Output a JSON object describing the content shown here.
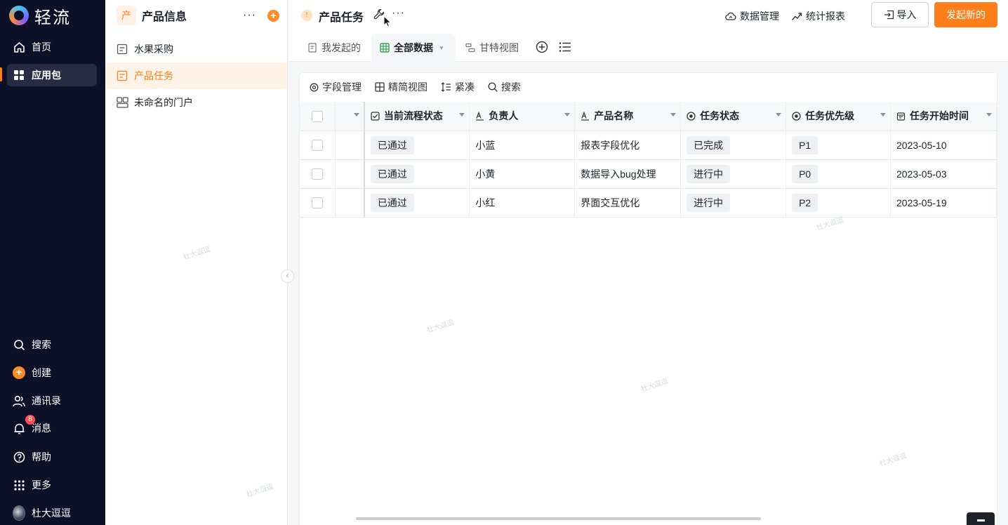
{
  "nav": {
    "brand": "轻流",
    "items": [
      {
        "label": "首页",
        "icon": "home-icon"
      },
      {
        "label": "应用包",
        "icon": "apps-icon"
      }
    ],
    "bottom": [
      {
        "label": "搜索",
        "icon": "search-icon"
      },
      {
        "label": "创建",
        "icon": "plus-icon"
      },
      {
        "label": "通讯录",
        "icon": "contacts-icon"
      },
      {
        "label": "消息",
        "icon": "bell-icon",
        "badge": "8"
      },
      {
        "label": "帮助",
        "icon": "help-icon"
      },
      {
        "label": "更多",
        "icon": "grid-icon"
      },
      {
        "label": "杜大逗逗",
        "icon": "avatar"
      }
    ]
  },
  "package": {
    "icon_text": "产",
    "title": "产品信息",
    "items": [
      {
        "label": "水果采购"
      },
      {
        "label": "产品任务"
      },
      {
        "label": "未命名的门户"
      }
    ]
  },
  "header": {
    "form_title": "产品任务",
    "links": [
      "数据管理",
      "统计报表"
    ],
    "import_label": "导入",
    "new_label": "发起新的"
  },
  "tabs": [
    {
      "label": "我发起的"
    },
    {
      "label": "全部数据"
    },
    {
      "label": "甘特视图"
    }
  ],
  "toolbar": [
    "字段管理",
    "精简视图",
    "紧凑",
    "搜索"
  ],
  "table": {
    "columns": [
      "当前流程状态",
      "负责人",
      "产品名称",
      "任务状态",
      "任务优先级",
      "任务开始时间"
    ],
    "rows": [
      {
        "flow": "已通过",
        "owner": "小蓝",
        "product": "报表字段优化",
        "status": "已完成",
        "priority": "P1",
        "start": "2023-05-10"
      },
      {
        "flow": "已通过",
        "owner": "小黄",
        "product": "数据导入bug处理",
        "status": "进行中",
        "priority": "P0",
        "start": "2023-05-03"
      },
      {
        "flow": "已通过",
        "owner": "小红",
        "product": "界面交互优化",
        "status": "进行中",
        "priority": "P2",
        "start": "2023-05-19"
      }
    ]
  },
  "colors": {
    "accent": "#ff7d1a",
    "nav_bg": "#0d1127"
  }
}
